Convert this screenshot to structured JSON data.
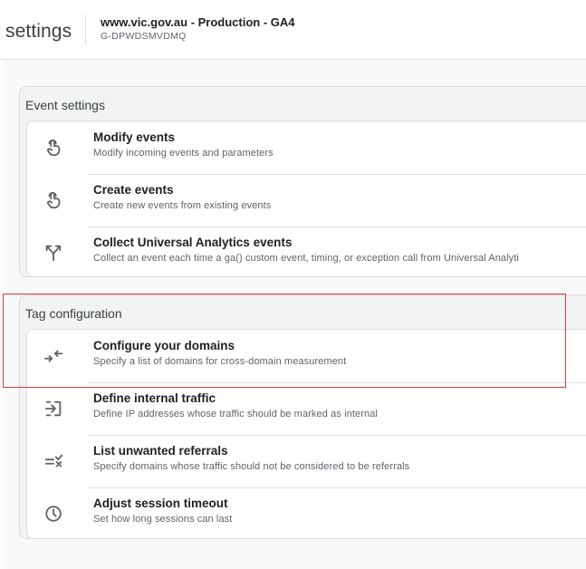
{
  "header": {
    "page_title": "settings",
    "property_name": "www.vic.gov.au - Production - GA4",
    "property_id": "G-DPWDSMVDMQ"
  },
  "sections": [
    {
      "title": "Event settings",
      "items": [
        {
          "title": "Modify events",
          "description": "Modify incoming events and parameters",
          "icon": "touch-icon"
        },
        {
          "title": "Create events",
          "description": "Create new events from existing events",
          "icon": "touch-icon"
        },
        {
          "title": "Collect Universal Analytics events",
          "description": "Collect an event each time a ga() custom event, timing, or exception call from Universal Analyti",
          "icon": "merge-arrows-icon"
        }
      ]
    },
    {
      "title": "Tag configuration",
      "items": [
        {
          "title": "Configure your domains",
          "description": "Specify a list of domains for cross-domain measurement",
          "icon": "converge-arrows-icon"
        },
        {
          "title": "Define internal traffic",
          "description": "Define IP addresses whose traffic should be marked as internal",
          "icon": "login-arrow-icon"
        },
        {
          "title": "List unwanted referrals",
          "description": "Specify domains whose traffic should not be considered to be referrals",
          "icon": "exclude-list-icon"
        },
        {
          "title": "Adjust session timeout",
          "description": "Set how long sessions can last",
          "icon": "clock-icon"
        }
      ]
    }
  ],
  "annotation": {
    "color": "#e53935"
  },
  "colors": {
    "icon": "#5f6368",
    "divider": "#e0e0e0",
    "background": "#f8f9fa"
  }
}
